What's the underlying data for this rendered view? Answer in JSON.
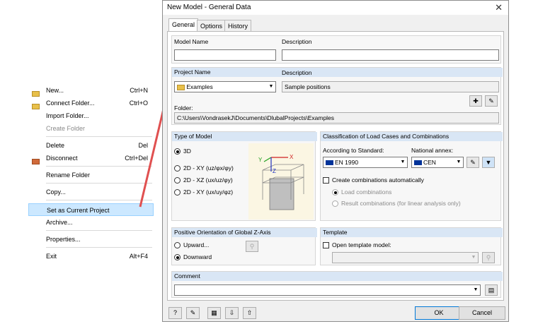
{
  "context_menu": {
    "items": [
      {
        "label": "New...",
        "shortcut": "Ctrl+N",
        "icon": "new-folder-icon"
      },
      {
        "label": "Connect Folder...",
        "shortcut": "Ctrl+O",
        "icon": "connect-folder-icon"
      },
      {
        "label": "Import Folder...",
        "shortcut": ""
      },
      {
        "label": "Create Folder",
        "shortcut": "",
        "disabled": true
      },
      {
        "label": "Delete",
        "shortcut": "Del"
      },
      {
        "label": "Disconnect",
        "shortcut": "Ctrl+Del",
        "icon": "disconnect-icon"
      },
      {
        "label": "Rename Folder",
        "shortcut": ""
      },
      {
        "label": "Copy...",
        "shortcut": ""
      },
      {
        "label": "Set as Current Project",
        "shortcut": "",
        "highlighted": true
      },
      {
        "label": "Archive...",
        "shortcut": ""
      },
      {
        "label": "Properties...",
        "shortcut": ""
      },
      {
        "label": "Exit",
        "shortcut": "Alt+F4"
      }
    ]
  },
  "dialog": {
    "title": "New Model - General Data",
    "close_glyph": "✕",
    "tabs": [
      "General",
      "Options",
      "History"
    ],
    "model_name_label": "Model Name",
    "model_name_value": "",
    "description_label": "Description",
    "description_value": "",
    "project_name_label": "Project Name",
    "project_name_value": "Examples",
    "project_description_label": "Description",
    "project_description_value": "Sample positions",
    "folder_label": "Folder:",
    "folder_value": "C:\\Users\\VondrasekJ\\Documents\\DlubalProjects\\Examples",
    "type_of_model": {
      "heading": "Type of Model",
      "options": [
        "3D",
        "2D - XY (uz/φx/φy)",
        "2D - XZ (ux/uz/φy)",
        "2D - XY (ux/uy/φz)"
      ],
      "selected": "3D"
    },
    "classification": {
      "heading": "Classification of Load Cases and Combinations",
      "standard_label": "According to Standard:",
      "standard_value": "EN 1990",
      "annex_label": "National annex:",
      "annex_value": "CEN",
      "create_auto_label": "Create combinations automatically",
      "load_combinations_label": "Load combinations",
      "result_combinations_label": "Result combinations (for linear analysis only)"
    },
    "orientation": {
      "heading": "Positive Orientation of Global Z-Axis",
      "upward_label": "Upward...",
      "downward_label": "Downward",
      "selected": "Downward"
    },
    "template": {
      "heading": "Template",
      "open_label": "Open template model:",
      "value": ""
    },
    "comment_label": "Comment",
    "comment_value": "",
    "ok_label": "OK",
    "cancel_label": "Cancel",
    "axis_labels": {
      "x": "X",
      "y": "Y",
      "z": "Z"
    }
  },
  "colors": {
    "group_header": "#d9e6f5",
    "highlight": "#cce8ff",
    "arrow": "#e05050"
  }
}
